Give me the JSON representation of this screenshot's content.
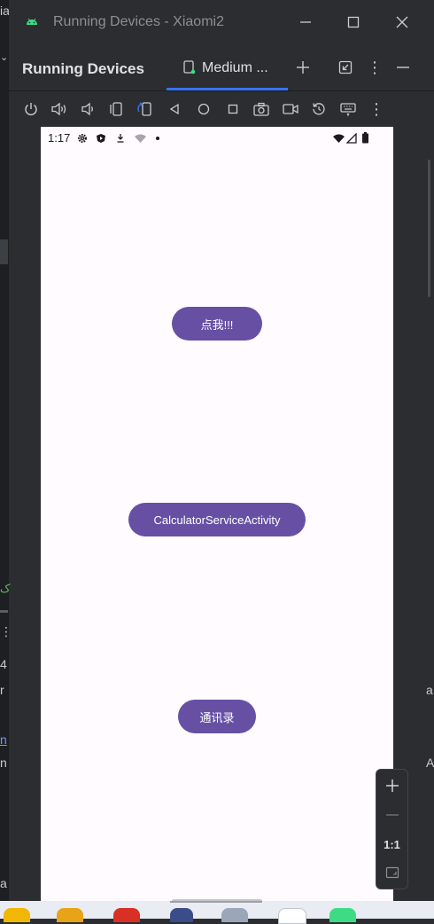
{
  "window": {
    "title": "Running Devices - Xiaomi2"
  },
  "panel": {
    "title": "Running Devices",
    "tab_label": "Medium ...",
    "header_icons": [
      "add-icon",
      "restore-icon",
      "more-icon",
      "minimize-icon"
    ]
  },
  "device_toolbar": {
    "icons": [
      "power-icon",
      "volume-up-icon",
      "volume-down-icon",
      "rotate-left-icon",
      "rotate-right-icon",
      "back-icon",
      "home-icon",
      "overview-icon",
      "screenshot-icon",
      "screen-record-icon",
      "reset-icon",
      "keyboard-icon",
      "more-icon"
    ]
  },
  "phone": {
    "status_bar": {
      "time": "1:17"
    },
    "buttons": {
      "click_me": "点我!!!",
      "calculator": "CalculatorServiceActivity",
      "contacts": "通讯录"
    }
  },
  "zoom": {
    "one_to_one": "1:1"
  },
  "left_fragments": {
    "a": "ia",
    "b": "4",
    "c": "r",
    "d": "n",
    "e": "n",
    "f": "a"
  },
  "right_fragments": {
    "a": "a",
    "b": "A"
  },
  "colors": {
    "accent": "#3574f0",
    "button": "#6750a4",
    "phone_bg": "#fffbfe",
    "ide_bg": "#2b2d30"
  }
}
